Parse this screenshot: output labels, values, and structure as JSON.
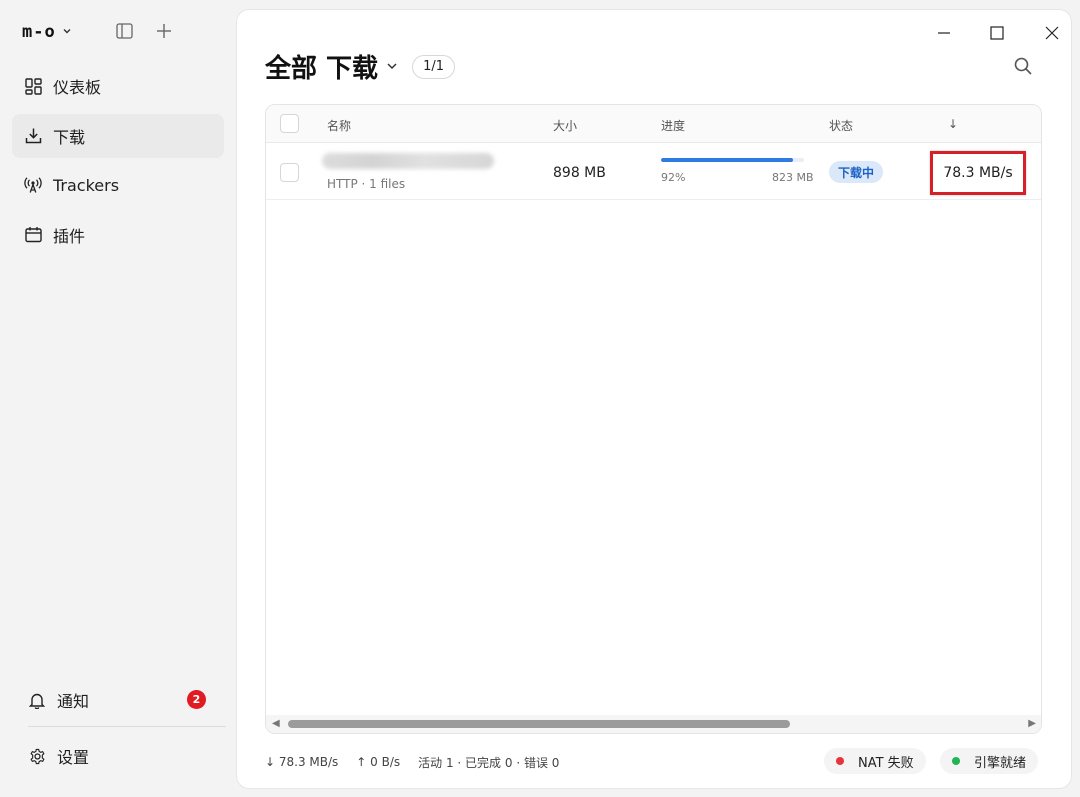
{
  "app": {
    "logo_text": "m-o"
  },
  "sidebar": {
    "items": [
      {
        "label": "仪表板",
        "icon": "dashboard-grid-icon",
        "active": false
      },
      {
        "label": "下载",
        "icon": "download-icon",
        "active": true
      },
      {
        "label": "Trackers",
        "icon": "antenna-icon",
        "active": false
      },
      {
        "label": "插件",
        "icon": "plugin-calendar-icon",
        "active": false
      }
    ],
    "notifications": {
      "label": "通知",
      "count": "2"
    },
    "settings": {
      "label": "设置"
    }
  },
  "main": {
    "title": "全部 下载",
    "count": "1/1",
    "table": {
      "headers": {
        "name": "名称",
        "size": "大小",
        "progress": "进度",
        "status": "状态",
        "speed": "↓"
      },
      "rows": [
        {
          "sub": "HTTP · 1 files",
          "size": "898 MB",
          "progress_fraction": 0.92,
          "progress_pct": "92%",
          "downloaded": "823 MB",
          "status": "下载中",
          "speed": "78.3 MB/s"
        }
      ]
    },
    "statusbar": {
      "down": "↓ 78.3 MB/s",
      "up": "↑ 0 B/s",
      "summary": "活动 1 · 已完成 0 · 错误 0",
      "nat": "NAT 失败",
      "engine": "引擎就绪"
    }
  },
  "colors": {
    "accent": "#2f7be0",
    "status_bg": "#dbe8fa",
    "status_text": "#1d63c4",
    "nat_dot": "#e5343b",
    "engine_dot": "#22b455",
    "highlight_box": "#d42026"
  }
}
